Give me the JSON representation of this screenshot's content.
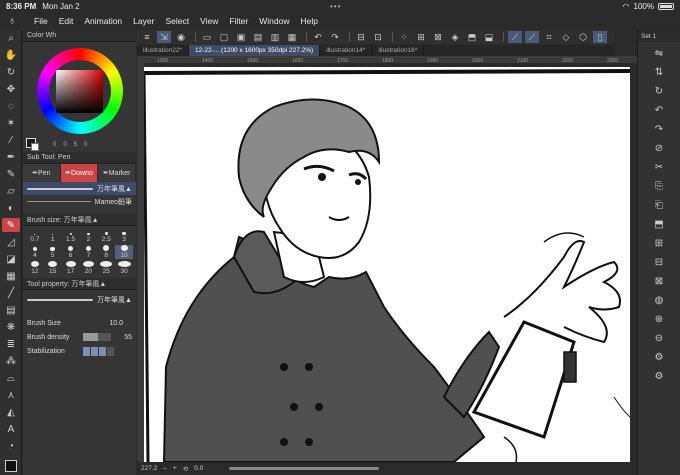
{
  "status": {
    "time": "8:36 PM",
    "date": "Mon Jan 2",
    "battery": "100%"
  },
  "menu": [
    "File",
    "Edit",
    "Animation",
    "Layer",
    "Select",
    "View",
    "Filter",
    "Window",
    "Help"
  ],
  "tools_left": [
    "zoom-icon",
    "hand-icon",
    "rotate-icon",
    "move-icon",
    "lasso-icon",
    "eyedropper-icon",
    "pen-icon",
    "eraser-icon",
    "fill-icon",
    "brush-icon",
    "shape-icon",
    "gradient-icon",
    "text-icon",
    "ruler-icon",
    "frame-icon",
    "correction-icon",
    "decoration-icon",
    "sparkle-icon",
    "blend-icon",
    "airbrush-icon"
  ],
  "color_panel": {
    "title": "Color Wh",
    "hsv": [
      "0",
      "0",
      "5",
      "0"
    ]
  },
  "subtool": {
    "title": "Sub Tool: Pen",
    "tabs": [
      "Pen",
      "Downo",
      "Marker"
    ],
    "brushes": [
      {
        "label": "万年筆風▲"
      },
      {
        "label": "Mameo鉛筆"
      }
    ]
  },
  "brush_size": {
    "title": "Brush size: 万年筆風▲",
    "sizes": [
      "0.7",
      "1",
      "1.5",
      "2",
      "2.5",
      "3",
      "4",
      "5",
      "6",
      "7",
      "8",
      "10",
      "12",
      "15",
      "17",
      "20",
      "25",
      "30"
    ],
    "selected": "10"
  },
  "tool_property": {
    "title": "Tool property: 万年筆風▲",
    "preset": "万年筆風▲",
    "brush_size_label": "Brush Size",
    "brush_size_value": "10.0",
    "brush_density_label": "Brush density",
    "brush_density_value": "55",
    "brush_density_fraction": 0.55,
    "stabilization_label": "Stabilization"
  },
  "doc_tabs": [
    "illustration22*",
    "12-22-... (1200 x 1600px 350dpi 227.2%)",
    "illustration14*",
    "illustration16*"
  ],
  "ruler_marks": [
    "1300",
    "1400",
    "1500",
    "1600",
    "1700",
    "1800",
    "1900",
    "2000",
    "2100",
    "2200",
    "2300"
  ],
  "bottom": {
    "zoom": "227.2",
    "angle": "0.0"
  },
  "right_panel": {
    "title": "Set 1",
    "icons": [
      "flip-horizontal-icon",
      "flip-vertical-icon",
      "rotate-icon",
      "undo-icon",
      "redo-icon",
      "clear-icon",
      "cut-icon",
      "copy-icon",
      "paste-icon",
      "transform-icon",
      "select-all-icon",
      "deselect-icon",
      "invert-icon",
      "lasso-fill-icon",
      "expand-icon",
      "shrink-icon",
      "settings-icon",
      "gear-icon"
    ]
  }
}
